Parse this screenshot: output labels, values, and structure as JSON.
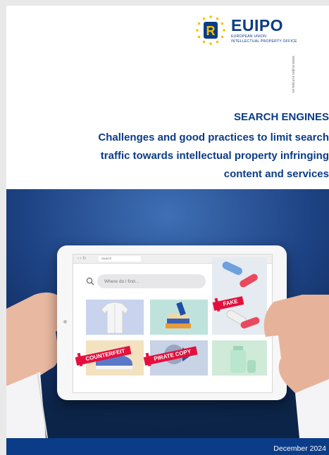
{
  "logo": {
    "wordmark": "EUIPO",
    "subtitle_line1": "European Union",
    "subtitle_line2": "Intellectual Property Office",
    "url": "www.euipo.europa.eu"
  },
  "title": {
    "main": "SEARCH ENGINES",
    "lines": [
      "Challenges and good practices to limit search",
      "traffic towards intellectual property infringing",
      "content and services"
    ]
  },
  "tablet_screen": {
    "browser_tab": "Search",
    "search_placeholder": "Where do i find...",
    "badges": {
      "fake": "FAKE",
      "counterfeit": "COUNTERFEIT",
      "pirate": "PIRATE COPY"
    }
  },
  "footer": {
    "date": "December 2024"
  },
  "colors": {
    "brand_blue": "#0b3c87",
    "badge_red": "#e3103d"
  }
}
